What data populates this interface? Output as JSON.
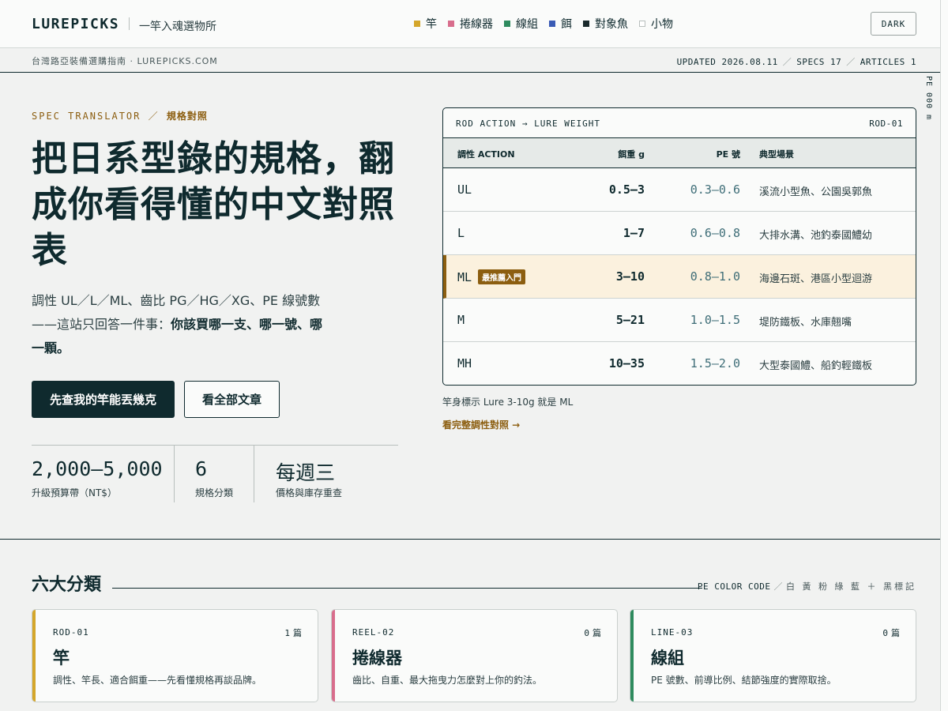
{
  "header": {
    "logo": "LUREPICKS",
    "tagline": "一竿入魂選物所",
    "nav": [
      {
        "label": "竿",
        "color": "#d4a62a"
      },
      {
        "label": "捲線器",
        "color": "#d86d8c"
      },
      {
        "label": "線組",
        "color": "#2e8b5e"
      },
      {
        "label": "餌",
        "color": "#3a5bb5"
      },
      {
        "label": "對象魚",
        "color": "#1a2a2c"
      },
      {
        "label": "小物",
        "color": "#ffffff"
      }
    ],
    "theme_button": "DARK"
  },
  "subbar": {
    "left": "台灣路亞裝備選購指南 · LUREPICKS.COM",
    "updated": "UPDATED 2026.08.11",
    "specs": "SPECS 17",
    "articles": "ARTICLES 1"
  },
  "rail_text": "PE 000 m",
  "hero": {
    "eyebrow_en": "SPEC TRANSLATOR",
    "eyebrow_sep": "／",
    "eyebrow_zh": "規格對照",
    "headline": "把日系型錄的規格，翻成你看得懂的中文對照表",
    "lead_plain": "調性 UL／L／ML、齒比 PG／HG／XG、PE 線號數——這站只回答一件事：",
    "lead_bold": "你該買哪一支、哪一號、哪一顆。",
    "primary_button": "先查我的竿能丟幾克",
    "secondary_button": "看全部文章",
    "stats": [
      {
        "value": "2,000–5,000",
        "label": "升級預算帶（NT$）"
      },
      {
        "value": "6",
        "label": "規格分類"
      },
      {
        "value": "每週三",
        "label": "價格與庫存重查"
      }
    ]
  },
  "table": {
    "title": "ROD ACTION → LURE WEIGHT",
    "code": "ROD-01",
    "headers": {
      "action": "調性 ACTION",
      "weight": "餌重 g",
      "pe": "PE 號",
      "scene": "典型場景"
    },
    "rows": [
      {
        "action": "UL",
        "badge": "",
        "weight": "0.5–3",
        "pe": "0.3–0.6",
        "scene": "溪流小型魚、公園吳郭魚"
      },
      {
        "action": "L",
        "badge": "",
        "weight": "1–7",
        "pe": "0.6–0.8",
        "scene": "大排水溝、池釣泰國鱧幼"
      },
      {
        "action": "ML",
        "badge": "最推薦入門",
        "weight": "3–10",
        "pe": "0.8–1.0",
        "scene": "海邊石斑、港區小型迴游"
      },
      {
        "action": "M",
        "badge": "",
        "weight": "5–21",
        "pe": "1.0–1.5",
        "scene": "堤防鐵板、水庫翹嘴"
      },
      {
        "action": "MH",
        "badge": "",
        "weight": "10–35",
        "pe": "1.5–2.0",
        "scene": "大型泰國鱧、船釣輕鐵板"
      }
    ],
    "note": "竿身標示 Lure 3-10g 就是 ML",
    "link": "看完整調性對照 →"
  },
  "categories": {
    "title": "六大分類",
    "legend_prefix": "PE COLOR CODE",
    "legend_sep": "／",
    "legend_colors": "白 黃 粉 綠 藍 ＋ 黑標記",
    "count_unit": "篇",
    "items": [
      {
        "code": "ROD-01",
        "count": "1",
        "name": "竿",
        "desc": "調性、竿長、適合餌重——先看懂規格再談品牌。",
        "color": "#d4a62a"
      },
      {
        "code": "REEL-02",
        "count": "0",
        "name": "捲線器",
        "desc": "齒比、自重、最大拖曳力怎麼對上你的釣法。",
        "color": "#d86d8c"
      },
      {
        "code": "LINE-03",
        "count": "0",
        "name": "線組",
        "desc": "PE 號數、前導比例、結節強度的實際取捨。",
        "color": "#2e8b5e"
      }
    ]
  }
}
